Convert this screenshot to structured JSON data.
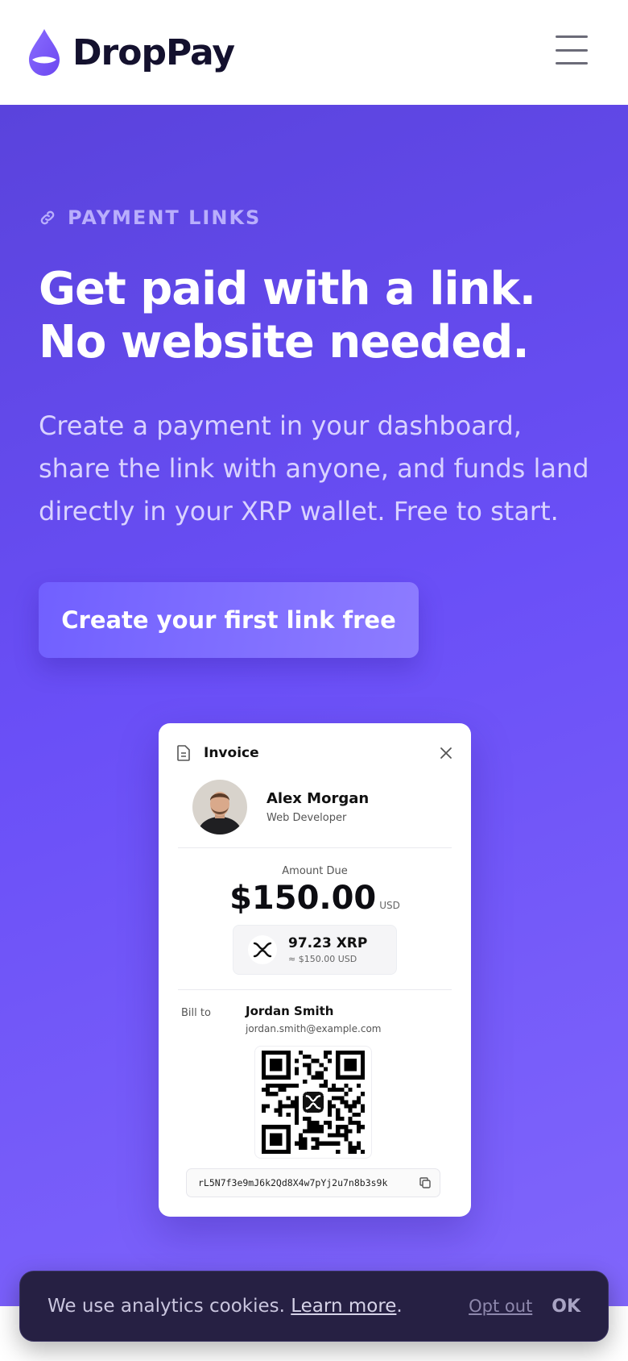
{
  "brand": {
    "name": "DropPay",
    "logo_icon": "drop-logo-icon",
    "accent": "#7a5cf5"
  },
  "header": {
    "menu_icon": "hamburger-menu-icon"
  },
  "hero": {
    "eyebrow_icon": "link-icon",
    "eyebrow": "PAYMENT LINKS",
    "headline_line1": "Get paid with a link.",
    "headline_line2": "No website needed.",
    "subcopy": "Create a payment in your dashboard, share the link with anyone, and funds land directly in your XRP wallet. Free to start.",
    "cta_label": "Create your first link free"
  },
  "invoice": {
    "title_icon": "document-icon",
    "title": "Invoice",
    "close_icon": "close-icon",
    "sender": {
      "name": "Alex Morgan",
      "role": "Web Developer"
    },
    "amount_label": "Amount Due",
    "amount": "$150.00",
    "currency": "USD",
    "xrp_icon": "xrp-icon",
    "xrp_amount": "97.23 XRP",
    "xrp_usd": "≈ $150.00 USD",
    "bill_to_label": "Bill to",
    "bill_to_name": "Jordan Smith",
    "bill_to_email": "jordan.smith@example.com",
    "qr_center_icon": "xrp-icon",
    "wallet_address": "rL5N7f3e9mJ6k2Qd8X4w7pYj2u7n8b3s9k",
    "copy_icon": "copy-icon"
  },
  "cookie": {
    "message": "We use analytics cookies.",
    "learn_more": "Learn more",
    "period": ".",
    "opt_out": "Opt out",
    "ok": "OK"
  }
}
